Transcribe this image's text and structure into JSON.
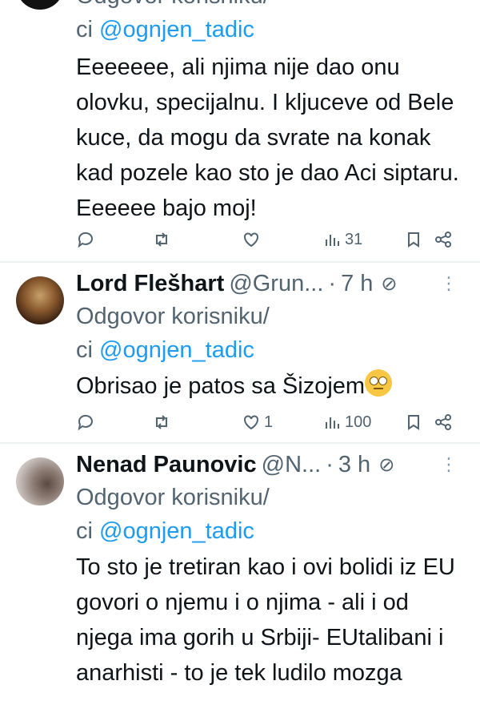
{
  "tweets": [
    {
      "reply_prefix_partial": "Odgovor korisniku/",
      "reply_prefix2": "ci ",
      "mention": "@ognjen_tadic",
      "text": "Eeeeeee, ali njima nije dao onu olovku, specijalnu. I kljuceve od Bele kuce, da mogu da svrate na konak kad pozele kao sto je dao Aci siptaru. Eeeeee bajo moj!",
      "replies": "",
      "retweets": "",
      "likes": "",
      "views": "31"
    },
    {
      "name": "Lord Flešhart",
      "handle": "@Grun...",
      "dot": "·",
      "time": "7 h",
      "reply_prefix": "Odgovor korisniku/",
      "reply_prefix2": "ci ",
      "mention": "@ognjen_tadic",
      "text": "Obrisao je patos sa Šizojem",
      "replies": "",
      "retweets": "",
      "likes": "1",
      "views": "100"
    },
    {
      "name": "Nenad Paunovic",
      "handle": "@N...",
      "dot": "·",
      "time": "3 h",
      "reply_prefix": "Odgovor korisniku/",
      "reply_prefix2": "ci ",
      "mention": "@ognjen_tadic",
      "text": "To sto je tretiran kao i ovi bolidi iz EU govori o njemu i o njima - ali i od  njega ima gorih u Srbiji- EUtalibani i anarhisti - to je tek ludilo mozga"
    }
  ],
  "icons": {
    "reply": "reply-icon",
    "retweet": "retweet-icon",
    "like": "heart-icon",
    "views": "views-icon",
    "bookmark": "bookmark-icon",
    "share": "share-icon",
    "more": "more-icon",
    "grok": "grok-icon",
    "emoji": "face-with-rolling-eyes-emoji"
  },
  "colors": {
    "link": "#1d9bf0",
    "muted": "#536471",
    "text": "#0f1419"
  }
}
